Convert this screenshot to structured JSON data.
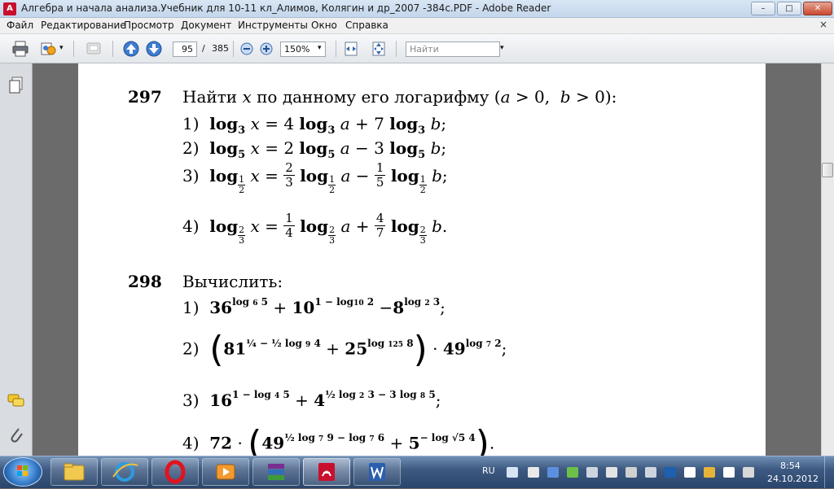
{
  "window": {
    "title": "Алгебра и начала анализа.Учебник для 10-11 кл_Алимов, Колягин и др_2007 -384с.PDF - Adobe Reader",
    "minimize": "–",
    "maximize": "□",
    "close": "✕"
  },
  "menu": {
    "items": [
      "Файл",
      "Редактирование",
      "Просмотр",
      "Документ",
      "Инструменты",
      "Окно",
      "Справка"
    ],
    "doc_close": "×"
  },
  "toolbar": {
    "page_current": "95",
    "page_separator": "/",
    "page_total": "385",
    "zoom": "150%",
    "search_placeholder": "Найти"
  },
  "document": {
    "p297": {
      "number": "297",
      "intro": "Найти",
      "var_x": "x",
      "intro_rest": "по данному его логарифму (",
      "cond": "a > 0, b > 0",
      "intro_end": "):",
      "items": [
        "1)",
        "2)",
        "3)",
        "4)"
      ]
    },
    "p298": {
      "number": "298",
      "intro": "Вычислить:",
      "items": [
        "1)",
        "2)",
        "3)",
        "4)"
      ]
    }
  },
  "taskbar": {
    "language": "RU",
    "time": "8:54",
    "date": "24.10.2012",
    "apps": [
      "explorer",
      "internet-explorer",
      "opera",
      "media-player",
      "winrar",
      "adobe-reader",
      "word"
    ]
  },
  "colors": {
    "taskbar": "#3e5a82",
    "page": "#ffffff",
    "background": "#6b6b6b"
  }
}
